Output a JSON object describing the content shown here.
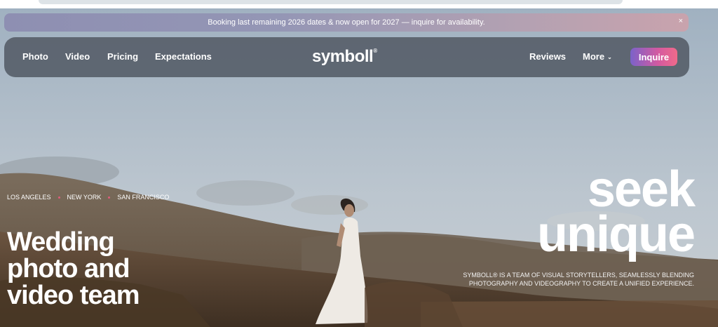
{
  "announcement": {
    "text": "Booking last remaining 2026 dates & now open for 2027 — inquire for availability.",
    "close_icon": "×"
  },
  "nav": {
    "left_links": [
      "Photo",
      "Video",
      "Pricing",
      "Expectations"
    ],
    "logo": "symboll",
    "logo_mark": "®",
    "reviews": "Reviews",
    "more": "More",
    "more_chevron": "⌄",
    "inquire": "Inquire"
  },
  "hero": {
    "cities": [
      "LOS ANGELES",
      "NEW YORK",
      "SAN FRANCISCO"
    ],
    "headline": [
      "Wedding",
      "photo and",
      "video team"
    ],
    "tagline": [
      "seek",
      "unique"
    ],
    "description": [
      "SYMBOLL® IS A TEAM OF VISUAL STORYTELLERS, SEAMLESSLY BLENDING",
      "PHOTOGRAPHY AND VIDEOGRAPHY TO CREATE A UNIFIED EXPERIENCE."
    ]
  },
  "colors": {
    "inquire_gradient_start": "#7b62c9",
    "inquire_gradient_end": "#f06a8a",
    "city_dot": "#e05b7b",
    "nav_background": "#58606a"
  }
}
